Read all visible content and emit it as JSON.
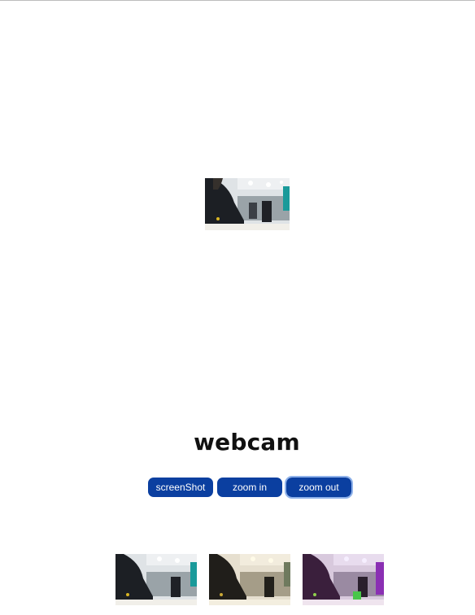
{
  "page": {
    "title": "webcam"
  },
  "controls": {
    "screenshot_label": "screenShot",
    "zoom_in_label": "zoom in",
    "zoom_out_label": "zoom out"
  },
  "thumbnails": [
    {
      "filter": "normal"
    },
    {
      "filter": "sepia"
    },
    {
      "filter": "purple-tint"
    }
  ],
  "colors": {
    "button_bg": "#0b3fa0",
    "button_text": "#ffffff",
    "title_text": "#111111"
  }
}
